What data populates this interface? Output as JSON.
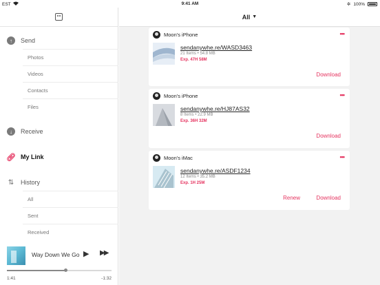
{
  "status_bar": {
    "carrier": "EST",
    "wifi_icon": "wifi-icon",
    "time": "9:41 AM",
    "bluetooth_icon": "bluetooth-icon",
    "battery_percent": "100%"
  },
  "sidebar": {
    "logo_icon": "app-logo-icon",
    "send": {
      "label": "Send",
      "items": [
        "Photos",
        "Videos",
        "Contacts",
        "Files"
      ]
    },
    "receive": {
      "label": "Receive"
    },
    "my_link": {
      "label": "My Link"
    },
    "history": {
      "label": "History",
      "items": [
        "All",
        "Sent",
        "Received"
      ]
    }
  },
  "player": {
    "track": "Way Down We Go",
    "elapsed": "1:41",
    "remaining": "-1:32",
    "progress": 0.56
  },
  "main": {
    "filter": {
      "label": "All"
    }
  },
  "links": [
    {
      "device": "Moon's iPhone",
      "url": "sendanywhe.re/WASD3463",
      "meta": "21 Items • 54.8 MB",
      "expires": "Exp. 47H 58M",
      "actions": [
        "Download"
      ]
    },
    {
      "device": "Moon's iPhone",
      "url": "sendanywhe.re/HJ87AS32",
      "meta": "8 Items • 22.9 MB",
      "expires": "Exp. 36H 32M",
      "actions": [
        "Download"
      ]
    },
    {
      "device": "Moon's iMac",
      "url": "sendanywhe.re/ASDF1234",
      "meta": "12 Items • 35.2 MB",
      "expires": "Exp. 1H 25M",
      "actions": [
        "Renew",
        "Download"
      ]
    }
  ],
  "colors": {
    "accent": "#e5335f",
    "sidebar_bg": "#ffffff",
    "main_bg": "#f2f2f2"
  }
}
